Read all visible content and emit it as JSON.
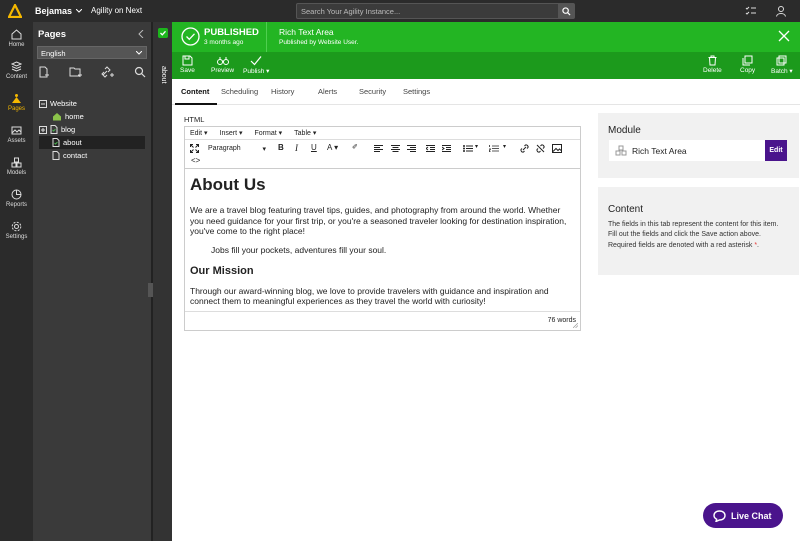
{
  "topbar": {
    "org_name": "Bejamas",
    "instance_name": "Agility on Next",
    "search_placeholder": "Search Your Agility Instance..."
  },
  "leftnav": [
    {
      "label": "Home",
      "icon": "home-icon"
    },
    {
      "label": "Content",
      "icon": "content-icon"
    },
    {
      "label": "Pages",
      "icon": "pages-icon",
      "active": true
    },
    {
      "label": "Assets",
      "icon": "assets-icon"
    },
    {
      "label": "Models",
      "icon": "models-icon"
    },
    {
      "label": "Reports",
      "icon": "reports-icon"
    },
    {
      "label": "Settings",
      "icon": "settings-icon"
    }
  ],
  "pages_panel": {
    "title": "Pages",
    "language": "English",
    "tree": {
      "root": "Website",
      "items": [
        "home",
        "blog",
        "about",
        "contact"
      ],
      "selected": "about"
    }
  },
  "side_tab": {
    "label": "about"
  },
  "status_bar": {
    "state": "PUBLISHED",
    "time": "3 months ago",
    "module_name": "Rich Text Area",
    "published_by": "Published by Website User."
  },
  "toolbar": {
    "save": "Save",
    "preview": "Preview",
    "publish": "Publish",
    "delete": "Delete",
    "copy": "Copy",
    "batch": "Batch"
  },
  "tabs": [
    "Content",
    "Scheduling",
    "History",
    "Alerts",
    "Security",
    "Settings"
  ],
  "editor": {
    "field_label": "HTML",
    "menus": [
      "Edit",
      "Insert",
      "Format",
      "Table"
    ],
    "paragraph_select": "Paragraph",
    "heading": "About Us",
    "paragraph1": "We are a travel blog featuring travel tips, guides, and photography from around the world. Whether you need guidance for your first trip, or you're a seasoned traveler looking for destination inspiration, you've come to the right place!",
    "quote": "Jobs fill your pockets, adventures fill your soul.",
    "subheading": "Our Mission",
    "paragraph2": "Through our award-winning blog, we love to provide travelers with guidance and inspiration and connect them to meaningful experiences as they travel the world with curiosity!",
    "word_count": "76 words"
  },
  "module_panel": {
    "title": "Module",
    "module_name": "Rich Text Area",
    "edit_label": "Edit"
  },
  "content_panel": {
    "title": "Content",
    "description": "The fields in this tab represent the content for this item.  Fill out the fields and click the Save action above.  Required fields are denoted with a red asterisk",
    "asterisk": "*",
    "period": "."
  },
  "live_chat": "Live Chat",
  "colors": {
    "published_green": "#23b523",
    "toolbar_green": "#1c9a1c",
    "accent_purple": "#4a148c",
    "nav_active": "#f5b800"
  }
}
